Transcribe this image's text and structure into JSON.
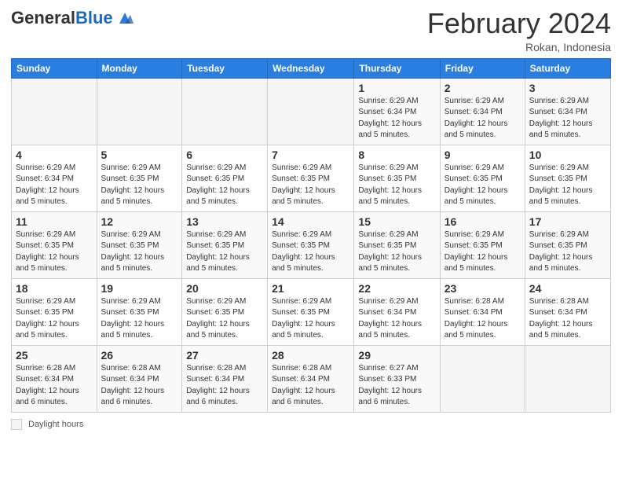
{
  "header": {
    "logo_general": "General",
    "logo_blue": "Blue",
    "month_title": "February 2024",
    "location": "Rokan, Indonesia"
  },
  "days_of_week": [
    "Sunday",
    "Monday",
    "Tuesday",
    "Wednesday",
    "Thursday",
    "Friday",
    "Saturday"
  ],
  "footer": {
    "label": "Daylight hours"
  },
  "weeks": [
    {
      "days": [
        {
          "num": "",
          "info": ""
        },
        {
          "num": "",
          "info": ""
        },
        {
          "num": "",
          "info": ""
        },
        {
          "num": "",
          "info": ""
        },
        {
          "num": "1",
          "info": "Sunrise: 6:29 AM\nSunset: 6:34 PM\nDaylight: 12 hours\nand 5 minutes."
        },
        {
          "num": "2",
          "info": "Sunrise: 6:29 AM\nSunset: 6:34 PM\nDaylight: 12 hours\nand 5 minutes."
        },
        {
          "num": "3",
          "info": "Sunrise: 6:29 AM\nSunset: 6:34 PM\nDaylight: 12 hours\nand 5 minutes."
        }
      ]
    },
    {
      "days": [
        {
          "num": "4",
          "info": "Sunrise: 6:29 AM\nSunset: 6:34 PM\nDaylight: 12 hours\nand 5 minutes."
        },
        {
          "num": "5",
          "info": "Sunrise: 6:29 AM\nSunset: 6:35 PM\nDaylight: 12 hours\nand 5 minutes."
        },
        {
          "num": "6",
          "info": "Sunrise: 6:29 AM\nSunset: 6:35 PM\nDaylight: 12 hours\nand 5 minutes."
        },
        {
          "num": "7",
          "info": "Sunrise: 6:29 AM\nSunset: 6:35 PM\nDaylight: 12 hours\nand 5 minutes."
        },
        {
          "num": "8",
          "info": "Sunrise: 6:29 AM\nSunset: 6:35 PM\nDaylight: 12 hours\nand 5 minutes."
        },
        {
          "num": "9",
          "info": "Sunrise: 6:29 AM\nSunset: 6:35 PM\nDaylight: 12 hours\nand 5 minutes."
        },
        {
          "num": "10",
          "info": "Sunrise: 6:29 AM\nSunset: 6:35 PM\nDaylight: 12 hours\nand 5 minutes."
        }
      ]
    },
    {
      "days": [
        {
          "num": "11",
          "info": "Sunrise: 6:29 AM\nSunset: 6:35 PM\nDaylight: 12 hours\nand 5 minutes."
        },
        {
          "num": "12",
          "info": "Sunrise: 6:29 AM\nSunset: 6:35 PM\nDaylight: 12 hours\nand 5 minutes."
        },
        {
          "num": "13",
          "info": "Sunrise: 6:29 AM\nSunset: 6:35 PM\nDaylight: 12 hours\nand 5 minutes."
        },
        {
          "num": "14",
          "info": "Sunrise: 6:29 AM\nSunset: 6:35 PM\nDaylight: 12 hours\nand 5 minutes."
        },
        {
          "num": "15",
          "info": "Sunrise: 6:29 AM\nSunset: 6:35 PM\nDaylight: 12 hours\nand 5 minutes."
        },
        {
          "num": "16",
          "info": "Sunrise: 6:29 AM\nSunset: 6:35 PM\nDaylight: 12 hours\nand 5 minutes."
        },
        {
          "num": "17",
          "info": "Sunrise: 6:29 AM\nSunset: 6:35 PM\nDaylight: 12 hours\nand 5 minutes."
        }
      ]
    },
    {
      "days": [
        {
          "num": "18",
          "info": "Sunrise: 6:29 AM\nSunset: 6:35 PM\nDaylight: 12 hours\nand 5 minutes."
        },
        {
          "num": "19",
          "info": "Sunrise: 6:29 AM\nSunset: 6:35 PM\nDaylight: 12 hours\nand 5 minutes."
        },
        {
          "num": "20",
          "info": "Sunrise: 6:29 AM\nSunset: 6:35 PM\nDaylight: 12 hours\nand 5 minutes."
        },
        {
          "num": "21",
          "info": "Sunrise: 6:29 AM\nSunset: 6:35 PM\nDaylight: 12 hours\nand 5 minutes."
        },
        {
          "num": "22",
          "info": "Sunrise: 6:29 AM\nSunset: 6:34 PM\nDaylight: 12 hours\nand 5 minutes."
        },
        {
          "num": "23",
          "info": "Sunrise: 6:28 AM\nSunset: 6:34 PM\nDaylight: 12 hours\nand 5 minutes."
        },
        {
          "num": "24",
          "info": "Sunrise: 6:28 AM\nSunset: 6:34 PM\nDaylight: 12 hours\nand 5 minutes."
        }
      ]
    },
    {
      "days": [
        {
          "num": "25",
          "info": "Sunrise: 6:28 AM\nSunset: 6:34 PM\nDaylight: 12 hours\nand 6 minutes."
        },
        {
          "num": "26",
          "info": "Sunrise: 6:28 AM\nSunset: 6:34 PM\nDaylight: 12 hours\nand 6 minutes."
        },
        {
          "num": "27",
          "info": "Sunrise: 6:28 AM\nSunset: 6:34 PM\nDaylight: 12 hours\nand 6 minutes."
        },
        {
          "num": "28",
          "info": "Sunrise: 6:28 AM\nSunset: 6:34 PM\nDaylight: 12 hours\nand 6 minutes."
        },
        {
          "num": "29",
          "info": "Sunrise: 6:27 AM\nSunset: 6:33 PM\nDaylight: 12 hours\nand 6 minutes."
        },
        {
          "num": "",
          "info": ""
        },
        {
          "num": "",
          "info": ""
        }
      ]
    }
  ]
}
